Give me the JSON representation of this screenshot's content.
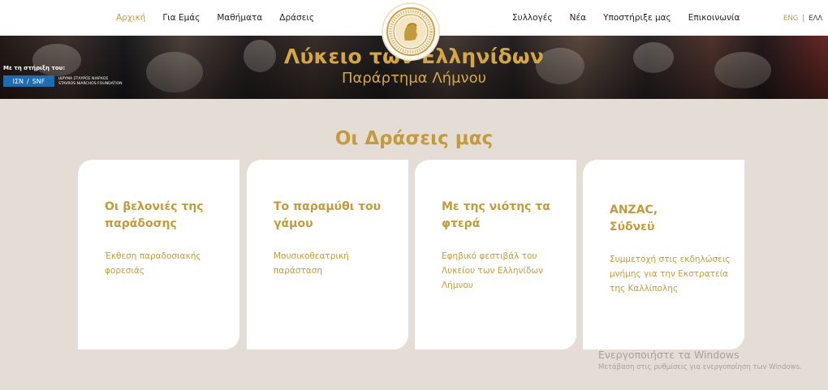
{
  "nav": {
    "left": [
      "Αρχική",
      "Για Εμάς",
      "Μαθήματα",
      "Δράσεις"
    ],
    "right": [
      "Συλλογές",
      "Νέα",
      "Υποστήριξε μας",
      "Επικοινωνία"
    ],
    "active_index": 0
  },
  "lang": {
    "eng": "ENG",
    "separator": "|",
    "ell": "ΕΛΛ"
  },
  "hero": {
    "title": "Λύκειο των Ελληνίδων",
    "subtitle": "Παράρτημα Λήμνου",
    "support_label": "Με τη στήριξη του:",
    "snf_left": "ΙΣΝ",
    "snf_sep": "/",
    "snf_right": "SNF",
    "snf_name_gr": "ΙΔΡΥΜΑ ΣΤΑΥΡΟΣ ΝΙΑΡΧΟΣ",
    "snf_name_en": "STAVROS NIARCHOS FOUNDATION"
  },
  "section_title": "Οι Δράσεις μας",
  "cards": [
    {
      "title": "Οι βελονιές της παράδοσης",
      "desc": "Έκθεση παραδοσιακής φορεσιάς"
    },
    {
      "title": "Το παραμύθι του γάμου",
      "desc": "Μουσικοθεατρική παράσταση"
    },
    {
      "title": "Με της νιότης τα φτερά",
      "desc": "Εφηβικό φεστιβάλ του Λυκείου των Ελληνίδων Λήμνου"
    },
    {
      "title": "ANZAC, Σύδνεϋ",
      "desc": "Συμμετοχή στις εκδηλώσεις μνήμης για την Εκστρατεία της Καλλίπολης"
    }
  ],
  "watermark": {
    "line1": "Ενεργοποιήστε τα Windows",
    "line2": "Μετάβαση στις ρυθμίσεις για ενεργοποίηση των Windows."
  },
  "colors": {
    "accent": "#c39a3c",
    "background": "#e4ddd5",
    "card": "#ffffff",
    "snf_blue": "#1f6db0"
  },
  "icons": {
    "logo": "lyceum-seal-icon"
  }
}
